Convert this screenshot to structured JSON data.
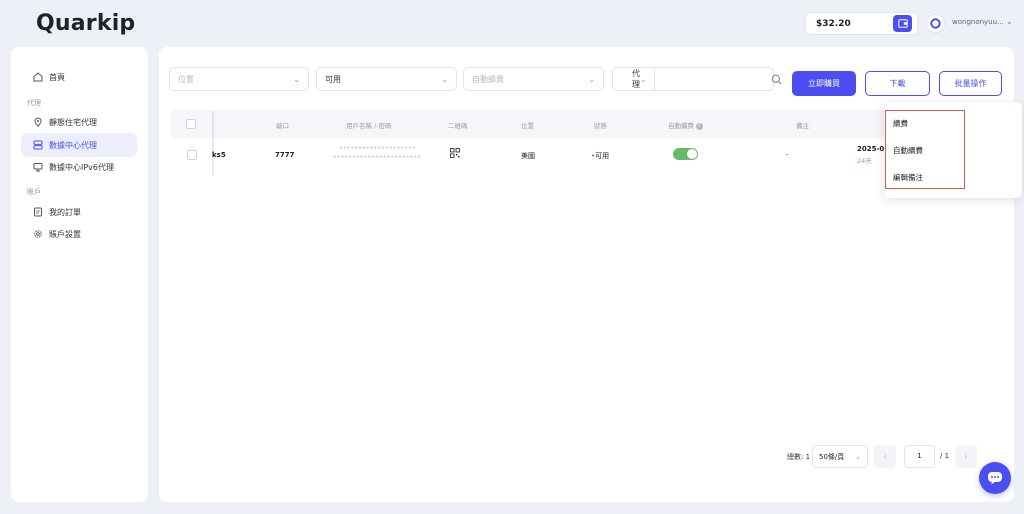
{
  "brand": {
    "logo_text": "Quarkip"
  },
  "header": {
    "balance": "$32.20",
    "user_name": "wong... ",
    "user_name_display": "wongnonyuu..."
  },
  "sidebar": {
    "items": [
      {
        "label": "首頁",
        "icon": "home-icon"
      },
      {
        "label": "靜態住宅代理",
        "icon": "location-pin-icon"
      },
      {
        "label": "數據中心代理",
        "icon": "server-icon"
      },
      {
        "label": "數據中心IPv6代理",
        "icon": "monitor-icon"
      },
      {
        "label": "我的訂單",
        "icon": "orders-icon"
      },
      {
        "label": "賬戶設置",
        "icon": "gear-icon"
      }
    ],
    "sections": {
      "proxy": "代理",
      "account": "賬戶"
    }
  },
  "filters": {
    "location_placeholder": "位置",
    "status_value": "可用",
    "auto_renew_placeholder": "自動續費",
    "search_type": "代理",
    "search_value": ""
  },
  "buttons": {
    "buy_now": "立即購買",
    "download": "下載",
    "batch": "批量操作"
  },
  "table": {
    "headers": [
      "端口",
      "用戶名稱 / 密碼",
      "二維碼",
      "位置",
      "狀態",
      "自動續費",
      "備注",
      "到期"
    ],
    "rows": [
      {
        "protocol": "ks5",
        "port": "7777",
        "credentials_line1": "••••••••••••••••••••",
        "credentials_line2": "•••••••••••••••••••••••",
        "location": "美國",
        "status": "可用",
        "status_dot": "•",
        "auto_renew": true,
        "note": "-",
        "expiry_date": "2025-06",
        "expiry_days": "24天"
      }
    ]
  },
  "dropdown": {
    "items": [
      "續費",
      "自動續費",
      "編輯備注"
    ]
  },
  "pagination": {
    "total": "總數: 1",
    "page_size": "50條/頁",
    "current_page": "1",
    "total_pages": "/ 1"
  },
  "colors": {
    "accent": "#4b4ef0",
    "success": "#66bb6a",
    "highlight": "#e2574c"
  }
}
